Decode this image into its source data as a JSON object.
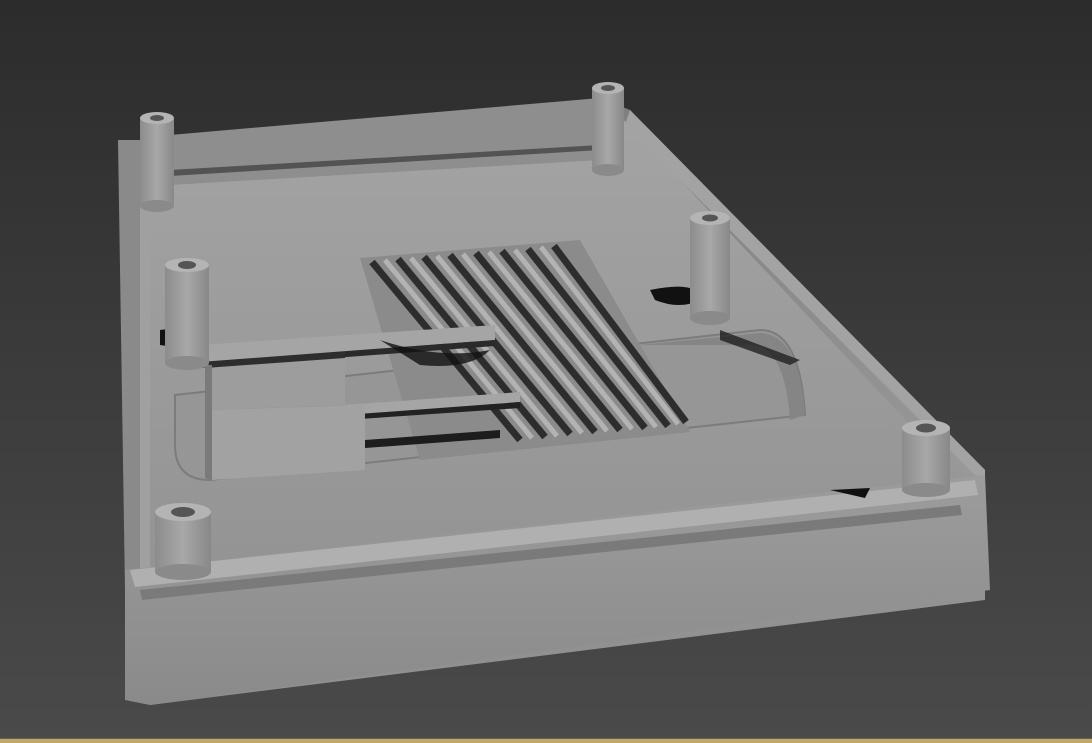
{
  "viewport": {
    "background_top": "#2c2c2c",
    "background_bottom": "#4a4a4a",
    "border_color": "#bfa86a"
  },
  "model": {
    "name": "enclosure-base-model",
    "surface_color": "#9a9a9a",
    "shadow_color": "#111111"
  }
}
